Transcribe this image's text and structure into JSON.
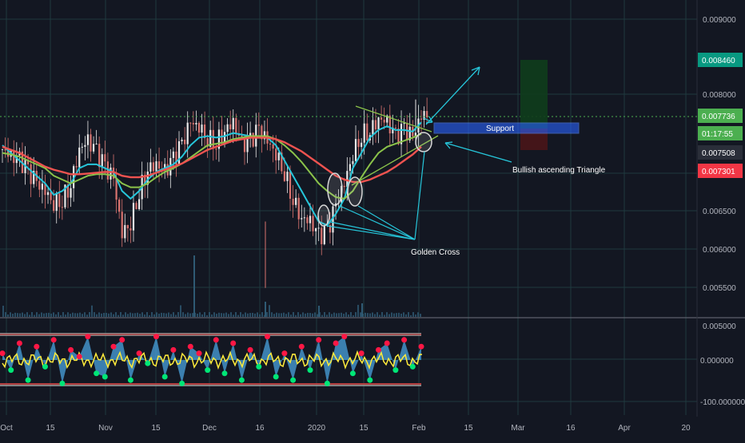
{
  "colors": {
    "background": "#131722",
    "grid": "#1f3a3f",
    "axis_text": "#b2b5be",
    "candle_up": "#e8e8e8",
    "candle_down": "#d9736f",
    "ema_fast": "#26c6da",
    "ema_mid": "#8bc34a",
    "ema_slow": "#ef5350",
    "annotation": "#26c6da",
    "support_fill": "#2962ff",
    "price_green": "#089981",
    "price_red": "#f23645",
    "osc_fill": "#4aa3df",
    "osc_line": "#ffeb3b"
  },
  "chart_data": [
    {
      "type": "candlestick",
      "series": [
        {
          "values": [
            0.00735,
            0.00725,
            0.0072,
            0.00705,
            0.0069,
            0.0068,
            0.00665,
            0.0067,
            0.0069,
            0.00735,
            0.00745,
            0.0073,
            0.0071,
            0.00695,
            0.00625,
            0.0064,
            0.0068,
            0.0071,
            0.00715,
            0.00705,
            0.0072,
            0.0074,
            0.0077,
            0.00765,
            0.0075,
            0.00745,
            0.0076,
            0.0077,
            0.0074,
            0.00745,
            0.0076,
            0.00745,
            0.0073,
            0.00705,
            0.0067,
            0.00645,
            0.0064,
            0.0062,
            0.00625,
            0.0066,
            0.0069,
            0.0073,
            0.00755,
            0.0076,
            0.00775,
            0.0077,
            0.0075,
            0.0076,
            0.0075,
            0.0078
          ]
        }
      ],
      "indicators": [
        {
          "kind": "ema_fast",
          "values": [
            0.0074,
            0.0073,
            0.0072,
            0.0071,
            0.007,
            0.0069,
            0.00675,
            0.0068,
            0.0069,
            0.0071,
            0.00715,
            0.00715,
            0.0071,
            0.00705,
            0.0068,
            0.0067,
            0.0068,
            0.00695,
            0.00705,
            0.0071,
            0.00715,
            0.00725,
            0.0074,
            0.0075,
            0.00752,
            0.0075,
            0.00752,
            0.00756,
            0.00754,
            0.00752,
            0.00752,
            0.0075,
            0.0074,
            0.0072,
            0.007,
            0.0068,
            0.0066,
            0.0064,
            0.00635,
            0.0065,
            0.0067,
            0.0071,
            0.0073,
            0.0075,
            0.0076,
            0.00765,
            0.0076,
            0.0076,
            0.00758,
            0.0077
          ]
        },
        {
          "kind": "ema_mid",
          "values": [
            0.0073,
            0.00728,
            0.00725,
            0.0072,
            0.00715,
            0.0071,
            0.007,
            0.00695,
            0.0069,
            0.00695,
            0.007,
            0.00702,
            0.00702,
            0.007,
            0.0069,
            0.00685,
            0.00685,
            0.0069,
            0.00698,
            0.00705,
            0.0071,
            0.00716,
            0.00724,
            0.00732,
            0.0074,
            0.00742,
            0.00744,
            0.00748,
            0.0075,
            0.00752,
            0.00752,
            0.00752,
            0.00748,
            0.0074,
            0.0073,
            0.00718,
            0.00704,
            0.0069,
            0.0068,
            0.00672,
            0.0067,
            0.0068,
            0.00698,
            0.00715,
            0.0073,
            0.00738,
            0.00742,
            0.00746,
            0.0075,
            0.00755
          ]
        },
        {
          "kind": "ema_slow",
          "values": [
            0.00738,
            0.00734,
            0.0073,
            0.00724,
            0.00718,
            0.00712,
            0.00708,
            0.00705,
            0.00702,
            0.00702,
            0.00703,
            0.00704,
            0.00705,
            0.00705,
            0.007,
            0.00698,
            0.00698,
            0.007,
            0.00704,
            0.00708,
            0.00712,
            0.00716,
            0.00722,
            0.00728,
            0.00734,
            0.00738,
            0.00742,
            0.00746,
            0.00748,
            0.0075,
            0.0075,
            0.0075,
            0.00748,
            0.00744,
            0.00738,
            0.00732,
            0.00724,
            0.00716,
            0.00708,
            0.007,
            0.00695,
            0.00692,
            0.00692,
            0.00695,
            0.007,
            0.00705,
            0.00712,
            0.0072,
            0.00728,
            0.00738
          ]
        }
      ],
      "y_ticks": [
        "0.009000",
        "0.008000",
        "0.006500",
        "0.006000",
        "0.005500",
        "0.005000"
      ],
      "price_labels": [
        {
          "label": "0.008460",
          "color": "#089981"
        },
        {
          "label": "0.007736",
          "color": "#4caf50"
        },
        {
          "label": "01:17:55",
          "color": "#4caf50"
        },
        {
          "label": "0.007508",
          "color": "#2a2e39"
        },
        {
          "label": "0.007301",
          "color": "#f23645"
        }
      ],
      "annotations": [
        "Support",
        "Bullish ascending Triangle",
        "Golden Cross"
      ]
    },
    {
      "type": "area",
      "series": [
        {
          "values": [
            20,
            -30,
            50,
            -60,
            40,
            -20,
            60,
            -70,
            30,
            10,
            70,
            -40,
            -50,
            40,
            60,
            -60,
            20,
            -10,
            70,
            -50,
            30,
            -70,
            40,
            20,
            -30,
            60,
            -40,
            50,
            -60,
            30,
            -20,
            70,
            -50,
            20,
            -60,
            40,
            -30,
            60,
            -70,
            50,
            70,
            -40,
            20,
            -60,
            30,
            50,
            -30,
            60,
            -20,
            40
          ]
        }
      ],
      "y_ticks": [
        "0.000000",
        "-100.000000"
      ]
    }
  ],
  "x_axis": {
    "ticks": [
      "Oct",
      "15",
      "Nov",
      "15",
      "Dec",
      "16",
      "2020",
      "15",
      "Feb",
      "15",
      "Mar",
      "16",
      "Apr",
      "20"
    ]
  }
}
